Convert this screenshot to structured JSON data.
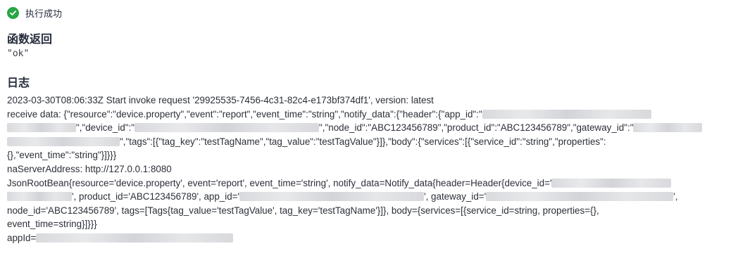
{
  "status": {
    "text": "执行成功",
    "icon": "check-circle-icon",
    "color": "#28a745"
  },
  "return_section": {
    "title": "函数返回",
    "value": "\"ok\""
  },
  "log_section": {
    "title": "日志",
    "lines": {
      "l1": "2023-03-30T08:06:33Z Start invoke request '29925535-7456-4c31-82c4-e173bf374df1', version: latest",
      "l2a": "receive data: {\"resource\":\"device.property\",\"event\":\"report\",\"event_time\":\"string\",\"notify_data\":{\"header\":{\"app_id\":\"",
      "l3a": "\",\"device_id\":\"",
      "l3b": "\",\"node_id\":\"ABC123456789\",\"product_id\":\"ABC123456789\",\"gateway_id\":\"",
      "l4a": "\",\"tags\":[{\"tag_key\":\"testTagName\",\"tag_value\":\"testTagValue\"}]},\"body\":{\"services\":[{\"service_id\":\"string\",\"properties\":",
      "l5": "{},\"event_time\":\"string\"}]}}}",
      "l6": "naServerAddress: http://127.0.0.1:8080",
      "l7a": "JsonRootBean{resource='device.property', event='report', event_time='string', notify_data=Notify_data{header=Header{device_id='",
      "l8a": "', product_id='ABC123456789', app_id='",
      "l8b": "', gateway_id='",
      "l8c": "',",
      "l9": "node_id='ABC123456789', tags=[Tags{tag_value='testTagValue', tag_key='testTagName'}]}, body={services=[{service_id=string, properties={},",
      "l10": "event_time=string}]}}}",
      "l11a": "appId="
    }
  }
}
